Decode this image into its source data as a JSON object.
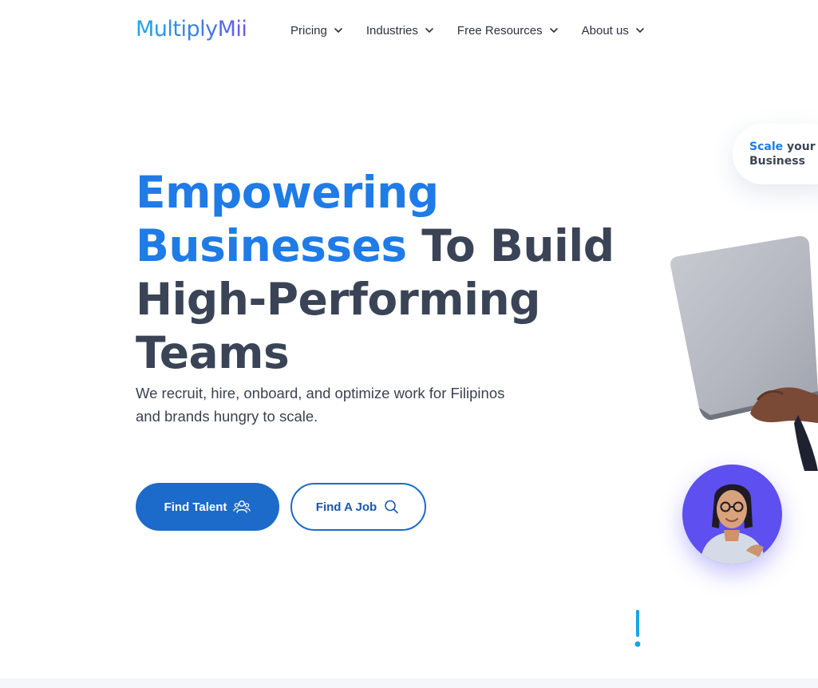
{
  "brand": {
    "logo_text": "MultiplyMii"
  },
  "nav": {
    "items": [
      {
        "label": "Pricing"
      },
      {
        "label": "Industries"
      },
      {
        "label": "Free Resources"
      },
      {
        "label": "About us"
      }
    ]
  },
  "hero": {
    "headline_blue_1": "Empowering",
    "headline_blue_2": "Businesses",
    "headline_rest_1": " To Build",
    "headline_rest_2": "High-Performing",
    "headline_rest_3": "Teams",
    "subtext": "We recruit, hire, onboard, and optimize work for Filipinos and brands hungry to scale.",
    "primary_button": "Find Talent",
    "secondary_button": "Find A Job"
  },
  "scale_card": {
    "word_blue": "Scale",
    "word_rest": " your",
    "line2": "Business"
  },
  "icons": {
    "primary_button_icon": "users-icon",
    "secondary_button_icon": "search-icon",
    "nav_chevron": "chevron-down-icon"
  },
  "colors": {
    "accent_blue": "#1f7be6",
    "button_blue": "#1c6ac9",
    "heading_dark": "#3a4456",
    "avatar_purple": "#5d4ff0"
  }
}
